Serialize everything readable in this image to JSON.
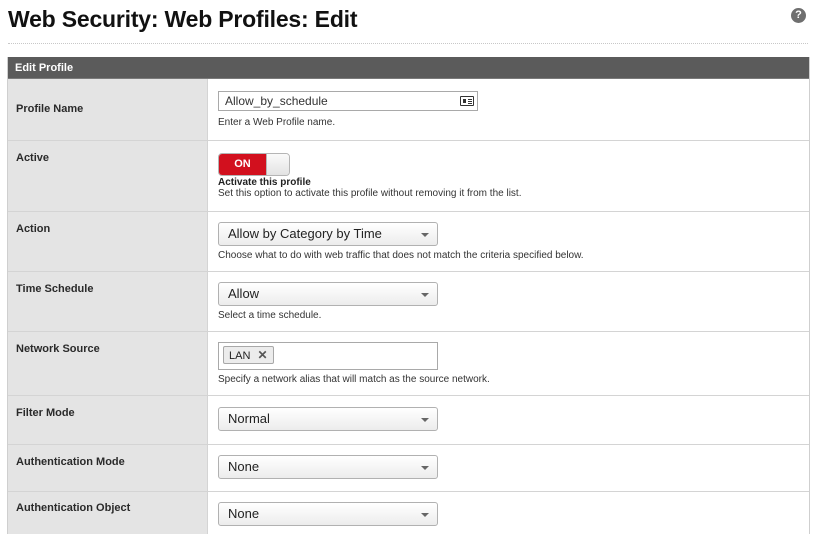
{
  "page": {
    "title": "Web Security: Web Profiles: Edit",
    "help_icon": "?"
  },
  "panel": {
    "header": "Edit Profile"
  },
  "fields": {
    "profile_name": {
      "label": "Profile Name",
      "value": "Allow_by_schedule",
      "hint": "Enter a Web Profile name.",
      "icon": "contact-card-icon"
    },
    "active": {
      "label": "Active",
      "toggle_label": "ON",
      "toggle_state": "on",
      "toggle_color": "#d2101e",
      "title": "Activate this profile",
      "hint": "Set this option to activate this profile without removing it from the list."
    },
    "action": {
      "label": "Action",
      "value": "Allow by Category by Time",
      "hint": "Choose what to do with web traffic that does not match the criteria specified below."
    },
    "time_schedule": {
      "label": "Time Schedule",
      "value": "Allow",
      "hint": "Select a time schedule."
    },
    "network_source": {
      "label": "Network Source",
      "tags": [
        "LAN"
      ],
      "tag_remove": "✕",
      "hint": "Specify a network alias that will match as the source network."
    },
    "filter_mode": {
      "label": "Filter Mode",
      "value": "Normal"
    },
    "authentication_mode": {
      "label": "Authentication Mode",
      "value": "None"
    },
    "authentication_object": {
      "label": "Authentication Object",
      "value": "None"
    }
  },
  "colors": {
    "header_bg": "#5b5b5b",
    "label_bg": "#e4e4e4",
    "toggle_on": "#d2101e"
  }
}
